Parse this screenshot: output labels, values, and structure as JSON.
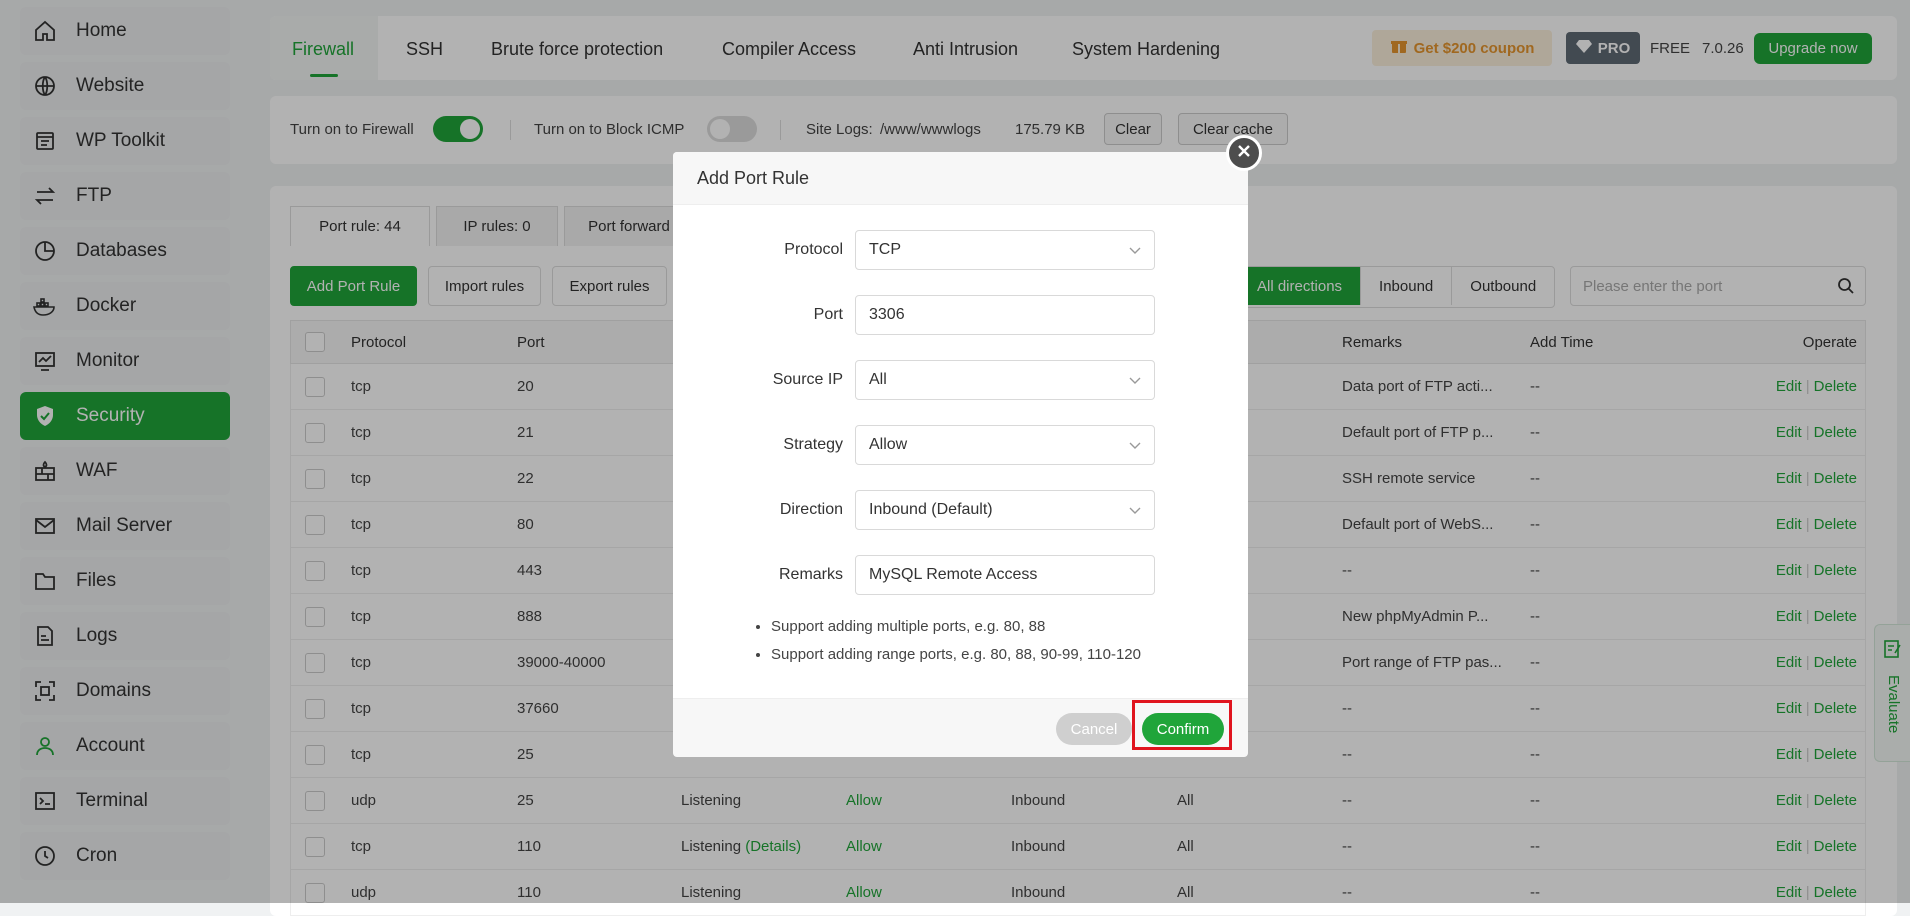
{
  "sidebar": {
    "items": [
      {
        "label": "Home",
        "icon": "home-icon"
      },
      {
        "label": "Website",
        "icon": "globe-icon"
      },
      {
        "label": "WP Toolkit",
        "icon": "wordpress-icon"
      },
      {
        "label": "FTP",
        "icon": "transfer-icon"
      },
      {
        "label": "Databases",
        "icon": "database-icon"
      },
      {
        "label": "Docker",
        "icon": "docker-icon"
      },
      {
        "label": "Monitor",
        "icon": "monitor-icon"
      },
      {
        "label": "Security",
        "icon": "shield-icon",
        "active": true
      },
      {
        "label": "WAF",
        "icon": "firewall-icon"
      },
      {
        "label": "Mail Server",
        "icon": "mail-icon"
      },
      {
        "label": "Files",
        "icon": "folder-icon"
      },
      {
        "label": "Logs",
        "icon": "logs-icon"
      },
      {
        "label": "Domains",
        "icon": "domains-icon"
      },
      {
        "label": "Account",
        "icon": "user-icon"
      },
      {
        "label": "Terminal",
        "icon": "terminal-icon"
      },
      {
        "label": "Cron",
        "icon": "clock-icon"
      }
    ]
  },
  "header": {
    "tabs": [
      "Firewall",
      "SSH",
      "Brute force protection",
      "Compiler Access",
      "Anti Intrusion",
      "System Hardening"
    ],
    "coupon": "Get $200 coupon",
    "pro": "PRO",
    "free": "FREE",
    "version": "7.0.26",
    "upgrade": "Upgrade now"
  },
  "status": {
    "firewall_label": "Turn on to Firewall",
    "firewall_on": true,
    "icmp_label": "Turn on to Block ICMP",
    "icmp_on": false,
    "site_logs_label": "Site Logs:",
    "site_logs_path": "/www/wwwlogs",
    "site_logs_size": "175.79 KB",
    "clear": "Clear",
    "clear_cache": "Clear cache"
  },
  "rules": {
    "subtabs": [
      "Port rule: 44",
      "IP rules: 0",
      "Port forward"
    ],
    "actions": [
      "Add Port Rule",
      "Import rules",
      "Export rules"
    ],
    "directions": [
      "All directions",
      "Inbound",
      "Outbound"
    ],
    "search_placeholder": "Please enter the port",
    "columns": {
      "protocol": "Protocol",
      "port": "Port",
      "remarks": "Remarks",
      "add_time": "Add Time",
      "operate": "Operate"
    },
    "edit": "Edit",
    "delete": "Delete",
    "rows": [
      {
        "protocol": "tcp",
        "port": "20",
        "status": "",
        "details": "",
        "strategy": "",
        "direction": "",
        "source": "",
        "remarks": "Data port of FTP acti...",
        "time": "--"
      },
      {
        "protocol": "tcp",
        "port": "21",
        "status": "",
        "details": "",
        "strategy": "",
        "direction": "",
        "source": "",
        "remarks": "Default port of FTP p...",
        "time": "--"
      },
      {
        "protocol": "tcp",
        "port": "22",
        "status": "",
        "details": "",
        "strategy": "",
        "direction": "",
        "source": "",
        "remarks": "SSH remote service",
        "time": "--"
      },
      {
        "protocol": "tcp",
        "port": "80",
        "status": "",
        "details": "",
        "strategy": "",
        "direction": "",
        "source": "",
        "remarks": "Default port of WebS...",
        "time": "--"
      },
      {
        "protocol": "tcp",
        "port": "443",
        "status": "",
        "details": "",
        "strategy": "",
        "direction": "",
        "source": "",
        "remarks": "--",
        "time": "--"
      },
      {
        "protocol": "tcp",
        "port": "888",
        "status": "",
        "details": "",
        "strategy": "",
        "direction": "",
        "source": "",
        "remarks": "New phpMyAdmin P...",
        "time": "--"
      },
      {
        "protocol": "tcp",
        "port": "39000-40000",
        "status": "",
        "details": "",
        "strategy": "",
        "direction": "",
        "source": "",
        "remarks": "Port range of FTP pas...",
        "time": "--"
      },
      {
        "protocol": "tcp",
        "port": "37660",
        "status": "",
        "details": "",
        "strategy": "",
        "direction": "",
        "source": "",
        "remarks": "--",
        "time": "--"
      },
      {
        "protocol": "tcp",
        "port": "25",
        "status": "",
        "details": "",
        "strategy": "",
        "direction": "",
        "source": "",
        "remarks": "--",
        "time": "--"
      },
      {
        "protocol": "udp",
        "port": "25",
        "status": "Listening",
        "details": "",
        "strategy": "Allow",
        "direction": "Inbound",
        "source": "All",
        "remarks": "--",
        "time": "--"
      },
      {
        "protocol": "tcp",
        "port": "110",
        "status": "Listening",
        "details": "(Details)",
        "strategy": "Allow",
        "direction": "Inbound",
        "source": "All",
        "remarks": "--",
        "time": "--"
      },
      {
        "protocol": "udp",
        "port": "110",
        "status": "Listening",
        "details": "",
        "strategy": "Allow",
        "direction": "Inbound",
        "source": "All",
        "remarks": "--",
        "time": "--"
      }
    ]
  },
  "modal": {
    "title": "Add Port Rule",
    "fields": [
      {
        "label": "Protocol",
        "value": "TCP",
        "type": "select"
      },
      {
        "label": "Port",
        "value": "3306",
        "type": "input"
      },
      {
        "label": "Source IP",
        "value": "All",
        "type": "select"
      },
      {
        "label": "Strategy",
        "value": "Allow",
        "type": "select"
      },
      {
        "label": "Direction",
        "value": "Inbound (Default)",
        "type": "select"
      },
      {
        "label": "Remarks",
        "value": "MySQL Remote Access",
        "type": "input"
      }
    ],
    "tips": [
      "Support adding multiple ports, e.g. 80, 88",
      "Support adding range ports, e.g. 80, 88, 90-99, 110-120"
    ],
    "cancel": "Cancel",
    "confirm": "Confirm"
  },
  "evaluate": "Evaluate",
  "colors": {
    "accent": "#20a53a",
    "highlight": "#e0141e",
    "coupon": "#e6952e"
  }
}
